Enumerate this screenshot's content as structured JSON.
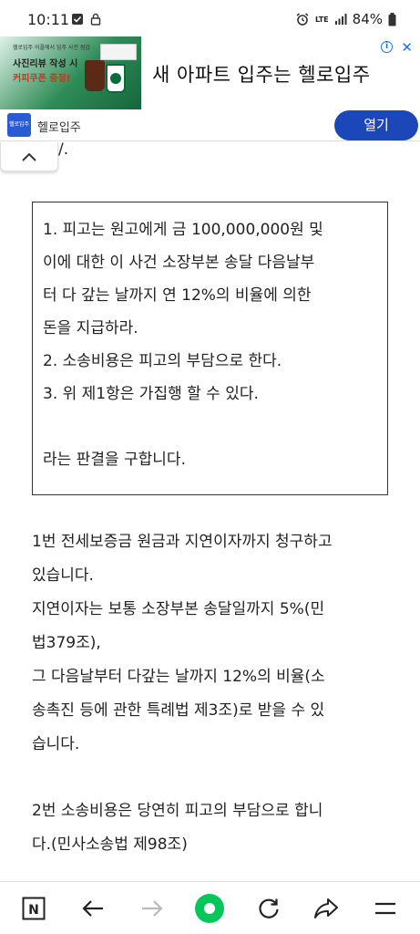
{
  "status_bar": {
    "time": "10:11",
    "network": "LTE",
    "battery": "84%"
  },
  "ad": {
    "image_small_text": "헬로입주 어플에서 입주 사전 점검",
    "image_review_text": "사진리뷰 작성 시",
    "image_coupon_text": "커피쿠폰 증정!",
    "headline": "새 아파트 입주는 헬로입주",
    "brand_logo_text": "헬로입주",
    "brand_name": "헬로입주",
    "open_label": "열기",
    "accent_color": "#1b47b8"
  },
  "article": {
    "partial_line": "/.",
    "claim_lines": [
      "1. 피고는 원고에게 금 100,000,000원 및",
      "이에 대한 이 사건 소장부본 송달 다음날부",
      "터 다 갚는 날까지 연 12%의 비율에 의한",
      "돈을 지급하라.",
      "2. 소송비용은 피고의 부담으로 한다.",
      "3. 위 제1항은 가집행 할 수 있다.",
      "라는 판결을 구합니다."
    ],
    "body_lines": [
      "1번 전세보증금 원금과 지연이자까지 청구하고",
      "있습니다.",
      "지연이자는 보통 소장부본 송달일까지 5%(민",
      "법379조),",
      "그 다음날부터 다갚는 날까지 12%의 비율(소",
      "송촉진 등에 관한 특례법 제3조)로 받을 수 있",
      "습니다.",
      "2번 소송비용은 당연히 피고의 부담으로 합니",
      "다.(민사소송법 제98조)"
    ]
  },
  "bottom_nav": {
    "home_label": "N",
    "icons": [
      "naver-home-icon",
      "back-arrow-icon",
      "forward-arrow-icon",
      "green-dot-icon",
      "refresh-icon",
      "share-icon",
      "menu-icon"
    ],
    "green_color": "#03c75a"
  }
}
